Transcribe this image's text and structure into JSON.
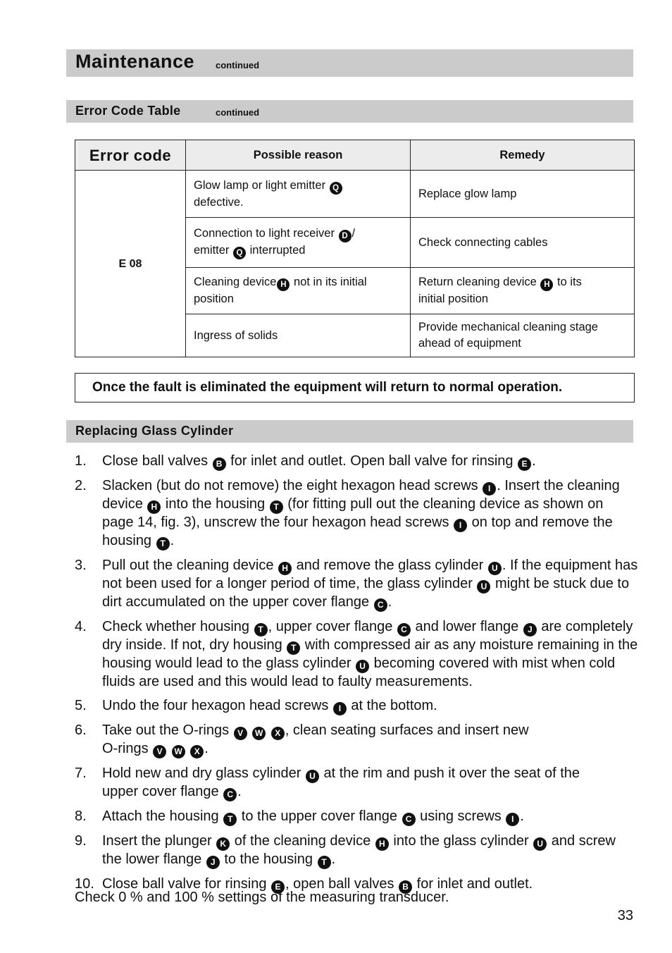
{
  "header": {
    "title": "Maintenance",
    "title_suffix": "continued"
  },
  "error_section": {
    "title": "Error Code Table",
    "title_suffix": "continued"
  },
  "error_table": {
    "headers": [
      "Error code",
      "Possible reason",
      "Remedy"
    ],
    "code": "E 08",
    "rows": [
      {
        "reason": [
          {
            "t": "Glow lamp or light emitter "
          },
          {
            "m": "Q"
          },
          {
            "br": true
          },
          {
            "t": "defective."
          }
        ],
        "remedy": [
          {
            "t": "Replace glow lamp"
          }
        ]
      },
      {
        "reason": [
          {
            "t": "Connection to light receiver "
          },
          {
            "m": "D"
          },
          {
            "t": "/"
          },
          {
            "br": true
          },
          {
            "t": "emitter "
          },
          {
            "m": "Q"
          },
          {
            "t": " interrupted"
          }
        ],
        "remedy": [
          {
            "t": "Check connecting cables"
          }
        ]
      },
      {
        "reason": [
          {
            "t": "Cleaning device"
          },
          {
            "m": "H"
          },
          {
            "t": " not in its initial"
          },
          {
            "br": true
          },
          {
            "t": "position"
          }
        ],
        "remedy": [
          {
            "t": "Return cleaning device "
          },
          {
            "m": "H"
          },
          {
            "t": " to its"
          },
          {
            "br": true
          },
          {
            "t": "initial position"
          }
        ]
      },
      {
        "reason": [
          {
            "t": "Ingress of solids"
          }
        ],
        "remedy": [
          {
            "t": "Provide mechanical cleaning stage"
          },
          {
            "br": true
          },
          {
            "t": "ahead of equipment"
          }
        ]
      }
    ]
  },
  "note": "Once the fault is eliminated the equipment will return to normal operation.",
  "replacing_section": {
    "title": "Replacing Glass Cylinder",
    "steps": [
      {
        "num": "1.",
        "segs": [
          {
            "t": "Close ball valves "
          },
          {
            "m": "B"
          },
          {
            "t": " for inlet and outlet. Open ball valve for rinsing "
          },
          {
            "m": "E"
          },
          {
            "t": "."
          }
        ]
      },
      {
        "num": "2.",
        "segs": [
          {
            "t": "Slacken (but do not remove) the eight hexagon head screws "
          },
          {
            "m": "I"
          },
          {
            "t": ". Insert the cleaning device "
          },
          {
            "m": "H"
          },
          {
            "t": " into the housing "
          },
          {
            "m": "T"
          },
          {
            "t": " (for fitting pull out the cleaning device as shown on page 14, fig. 3), unscrew the four hexagon head screws "
          },
          {
            "m": "I"
          },
          {
            "t": " on top and remove the housing "
          },
          {
            "m": "T"
          },
          {
            "t": "."
          }
        ]
      },
      {
        "num": "3.",
        "segs": [
          {
            "t": "Pull out the cleaning device "
          },
          {
            "m": "H"
          },
          {
            "t": " and remove the glass cylinder "
          },
          {
            "m": "U"
          },
          {
            "t": ". If the equipment has not been used for a longer period of time, the glass cylinder "
          },
          {
            "m": "U"
          },
          {
            "t": " might be stuck due to dirt accumulated on the upper cover flange "
          },
          {
            "m": "C"
          },
          {
            "t": "."
          }
        ]
      },
      {
        "num": "4.",
        "segs": [
          {
            "t": "Check whether housing "
          },
          {
            "m": "T"
          },
          {
            "t": ", upper cover flange "
          },
          {
            "m": "C"
          },
          {
            "t": " and lower flange "
          },
          {
            "m": "J"
          },
          {
            "t": " are completely dry inside. If not, dry housing "
          },
          {
            "m": "T"
          },
          {
            "t": " with compressed air as any moisture remaining in the housing would lead to the glass cylinder "
          },
          {
            "m": "U"
          },
          {
            "t": " becoming covered with mist when cold fluids are used and this would lead to faulty measurements."
          }
        ]
      },
      {
        "num": "5.",
        "segs": [
          {
            "t": "Undo the four hexagon head screws "
          },
          {
            "m": "I"
          },
          {
            "t": " at the bottom."
          }
        ]
      },
      {
        "num": "6.",
        "segs": [
          {
            "t": "Take out the O-rings "
          },
          {
            "m": "V"
          },
          {
            "t": " "
          },
          {
            "m": "W"
          },
          {
            "t": " "
          },
          {
            "m": "X"
          },
          {
            "t": ", clean seating surfaces and insert new"
          },
          {
            "br": true
          },
          {
            "t": "O-rings "
          },
          {
            "m": "V"
          },
          {
            "t": " "
          },
          {
            "m": "W"
          },
          {
            "t": " "
          },
          {
            "m": "X"
          },
          {
            "t": "."
          }
        ]
      },
      {
        "num": "7.",
        "segs": [
          {
            "t": "Hold new and dry glass cylinder "
          },
          {
            "m": "U"
          },
          {
            "t": " at the rim and push it over the seat of the"
          },
          {
            "br": true
          },
          {
            "t": "upper cover flange "
          },
          {
            "m": "C"
          },
          {
            "t": "."
          }
        ]
      },
      {
        "num": "8.",
        "segs": [
          {
            "t": "Attach the housing "
          },
          {
            "m": "T"
          },
          {
            "t": " to the upper cover flange "
          },
          {
            "m": "C"
          },
          {
            "t": " using screws "
          },
          {
            "m": "I"
          },
          {
            "t": "."
          }
        ]
      },
      {
        "num": "9.",
        "segs": [
          {
            "t": "Insert the plunger "
          },
          {
            "m": "K"
          },
          {
            "t": " of the cleaning device "
          },
          {
            "m": "H"
          },
          {
            "t": " into the glass cylinder "
          },
          {
            "m": "U"
          },
          {
            "t": " and screw the lower flange "
          },
          {
            "m": "J"
          },
          {
            "t": " to the housing "
          },
          {
            "m": "T"
          },
          {
            "t": "."
          }
        ]
      },
      {
        "num": "10.",
        "segs": [
          {
            "t": "Close ball valve for rinsing "
          },
          {
            "m": "E"
          },
          {
            "t": ", open ball valves "
          },
          {
            "m": "B"
          },
          {
            "t": " for inlet and outlet."
          }
        ]
      }
    ],
    "closing": "Check 0 % and 100 % settings of the measuring transducer."
  },
  "page_number": "33"
}
